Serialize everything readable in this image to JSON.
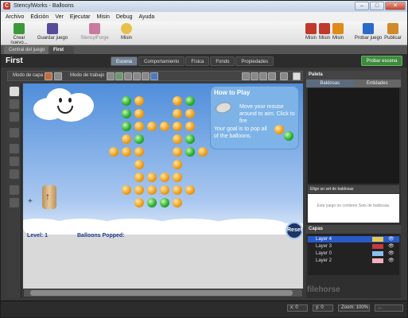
{
  "window": {
    "title": "StencylWorks - Balloons",
    "app_letter": "C"
  },
  "window_controls": {
    "minimize": "–",
    "maximize": "□",
    "close": "✕"
  },
  "menu": [
    "Archivo",
    "Edición",
    "Ver",
    "Ejecutar",
    "Misin",
    "Debug",
    "Ayuda"
  ],
  "toolbar": {
    "left": [
      {
        "label": "Crear nuevo...",
        "icon": "new-file-icon",
        "color": "#3a9a3a"
      },
      {
        "label": "Guardar juego",
        "icon": "save-icon",
        "color": "#5a4a9a"
      },
      {
        "label": "StencylForge",
        "icon": "forge-icon",
        "color": "#c87aa0"
      },
      {
        "label": "Misin",
        "icon": "chat-icon",
        "color": "#e6c04a"
      }
    ],
    "right": [
      {
        "label": "Misin",
        "icon": "mission-icon",
        "color": "#c0392b"
      },
      {
        "label": "Misin",
        "icon": "mission-icon",
        "color": "#c0392b"
      },
      {
        "label": "Misin",
        "icon": "bell-icon",
        "color": "#e08a1a"
      },
      {
        "label": "Probar juego",
        "icon": "test-arrow-icon",
        "color": "#2a6ac8"
      },
      {
        "label": "Publicar",
        "icon": "publish-icon",
        "color": "#d08a2a"
      }
    ]
  },
  "doc_tabs": [
    {
      "label": "Central del juego",
      "active": false
    },
    {
      "label": "First",
      "active": true
    }
  ],
  "doc_tab_close": "×",
  "scene": {
    "title": "First",
    "tabs": [
      "Escena",
      "Comportamiento",
      "Física",
      "Fondo",
      "Propiedades"
    ],
    "active_tab": "Escena",
    "play_button": "Probar escena"
  },
  "modebar": {
    "layer_mode": "Modo de capa",
    "work_mode": "Modo de trabajo"
  },
  "canvas": {
    "howto_title": "How to Play",
    "howto_line1": "Move your mouse around to aim. Click to fire",
    "howto_line2": "Your goal is to pop all of the balloons.",
    "level_label": "Level: 1",
    "popped_label": "Balloons Popped:",
    "reset": "Reset",
    "plus": "+",
    "cannon_arrow": "↑"
  },
  "palette": {
    "header": "Paleta",
    "tabs": [
      "Baldosas",
      "Entidades"
    ],
    "tileset_header": "Elige un set de baldosas",
    "tileset_empty": "Este juego no contiene Sets de baldosas."
  },
  "layers": {
    "header": "Capas",
    "items": [
      {
        "name": "Layer 4",
        "color": "#e8c84a",
        "selected": true
      },
      {
        "name": "Layer 3",
        "color": "#c83a3a",
        "selected": false
      },
      {
        "name": "Layer 0",
        "color": "#8ac0f0",
        "selected": false
      },
      {
        "name": "Layer 2",
        "color": "#f0b0c0",
        "selected": false
      }
    ],
    "eye": "👁"
  },
  "status": {
    "x": "x: 0",
    "y": "y: 0",
    "zoom": "Zoom: 100%",
    "extra": "..."
  },
  "watermark": "filehorse"
}
